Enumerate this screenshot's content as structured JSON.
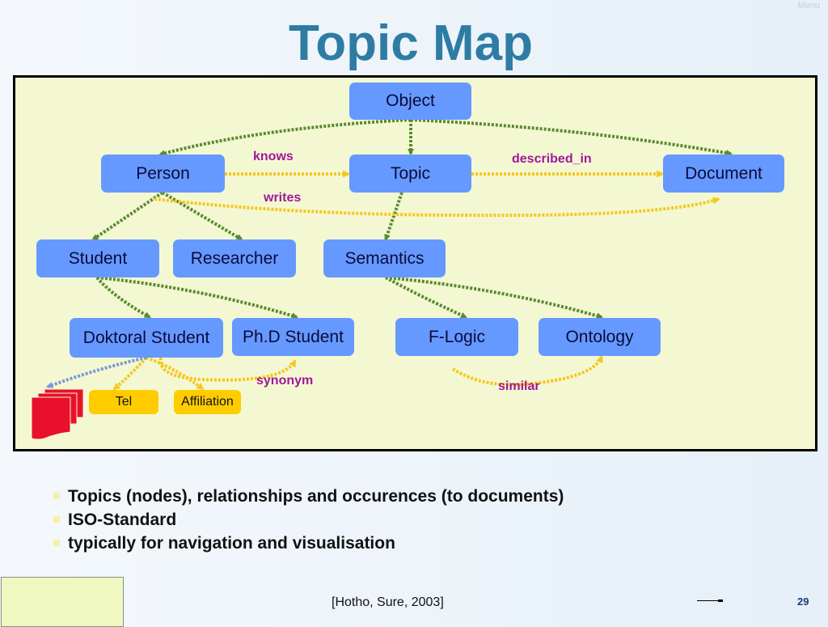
{
  "menu_label": "Menu",
  "title": "Topic Map",
  "diagram": {
    "colors": {
      "topic_fill": "#6699ff",
      "occurrence_fill": "#ffcc00",
      "is_a_edge": "#5a8a32",
      "association_edge": "#f4c820",
      "occurrence_edge": "#7a9ad8",
      "relation_label": "#a0189a",
      "document_icon": "#ee1122"
    },
    "topics": [
      {
        "id": "object",
        "label": "Object"
      },
      {
        "id": "person",
        "label": "Person"
      },
      {
        "id": "topic",
        "label": "Topic"
      },
      {
        "id": "document",
        "label": "Document"
      },
      {
        "id": "student",
        "label": "Student"
      },
      {
        "id": "researcher",
        "label": "Researcher"
      },
      {
        "id": "semantics",
        "label": "Semantics"
      },
      {
        "id": "doktoral_student",
        "label": "Doktoral Student"
      },
      {
        "id": "phd_student",
        "label": "Ph.D Student"
      },
      {
        "id": "f_logic",
        "label": "F-Logic"
      },
      {
        "id": "ontology",
        "label": "Ontology"
      }
    ],
    "occurrences": [
      {
        "id": "tel",
        "label": "Tel"
      },
      {
        "id": "affiliation",
        "label": "Affiliation"
      }
    ],
    "relations": {
      "knows": "knows",
      "described_in": "described_in",
      "writes": "writes",
      "synonym": "synonym",
      "similar": "similar"
    },
    "edges": [
      {
        "from": "object",
        "to": "person",
        "type": "is_a"
      },
      {
        "from": "object",
        "to": "topic",
        "type": "is_a"
      },
      {
        "from": "object",
        "to": "document",
        "type": "is_a"
      },
      {
        "from": "person",
        "to": "student",
        "type": "is_a"
      },
      {
        "from": "person",
        "to": "researcher",
        "type": "is_a"
      },
      {
        "from": "topic",
        "to": "semantics",
        "type": "is_a"
      },
      {
        "from": "student",
        "to": "doktoral_student",
        "type": "is_a"
      },
      {
        "from": "student",
        "to": "phd_student",
        "type": "is_a"
      },
      {
        "from": "semantics",
        "to": "f_logic",
        "type": "is_a"
      },
      {
        "from": "semantics",
        "to": "ontology",
        "type": "is_a"
      },
      {
        "from": "person",
        "to": "topic",
        "type": "association",
        "label": "knows"
      },
      {
        "from": "topic",
        "to": "document",
        "type": "association",
        "label": "described_in"
      },
      {
        "from": "person",
        "to": "document",
        "type": "association",
        "label": "writes"
      },
      {
        "from": "doktoral_student",
        "to": "phd_student",
        "type": "association",
        "label": "synonym"
      },
      {
        "from": "f_logic",
        "to": "ontology",
        "type": "association",
        "label": "similar"
      },
      {
        "from": "doktoral_student",
        "to": "tel",
        "type": "occurrence"
      },
      {
        "from": "doktoral_student",
        "to": "affiliation",
        "type": "occurrence"
      },
      {
        "from": "doktoral_student",
        "to": "documents",
        "type": "occurrence_link"
      }
    ]
  },
  "bullets": [
    "Topics (nodes), relationships and occurences (to documents)",
    "ISO-Standard",
    "typically for navigation and visualisation"
  ],
  "citation": "[Hotho, Sure, 2003]",
  "page_number": "29"
}
